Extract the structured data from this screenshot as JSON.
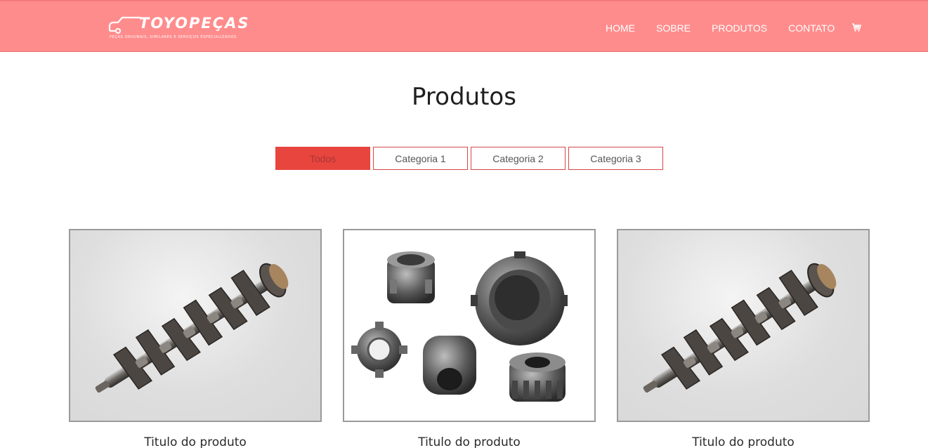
{
  "brand": {
    "name": "TOYOPEÇAS",
    "tagline": "PEÇAS ORIGINAIS, SIMILARES E SERVIÇOS ESPECIALIZADOS"
  },
  "nav": {
    "items": [
      {
        "label": "HOME"
      },
      {
        "label": "SOBRE"
      },
      {
        "label": "PRODUTOS"
      },
      {
        "label": "CONTATO"
      }
    ],
    "cart_icon": "cart-icon"
  },
  "page": {
    "title": "Produtos"
  },
  "filters": [
    {
      "label": "Todos",
      "active": true
    },
    {
      "label": "Categoria 1",
      "active": false
    },
    {
      "label": "Categoria 2",
      "active": false
    },
    {
      "label": "Categoria 3",
      "active": false
    }
  ],
  "products": [
    {
      "title": "Titulo do produto",
      "image": "crankshaft-image"
    },
    {
      "title": "Titulo do produto",
      "image": "gears-image"
    },
    {
      "title": "Titulo do produto",
      "image": "crankshaft-image"
    }
  ],
  "colors": {
    "header_bg": "#ff8c8c",
    "accent": "#e8453f"
  }
}
